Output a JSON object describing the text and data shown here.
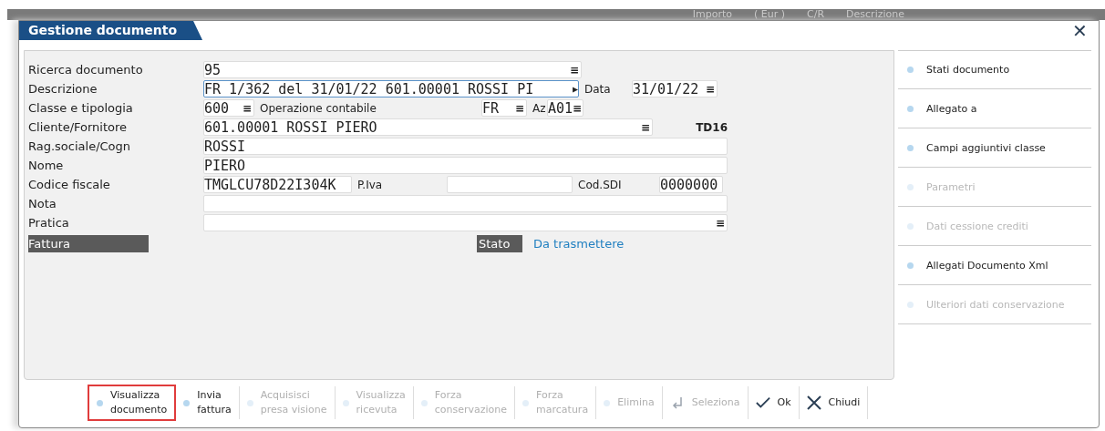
{
  "background_header": [
    "Importo",
    "( Eur )",
    "C/R",
    "Descrizione"
  ],
  "window": {
    "title": "Gestione documento",
    "close": "✕"
  },
  "form": {
    "rows": [
      {
        "label": "Ricerca documento",
        "items": [
          {
            "kind": "field",
            "value": "95",
            "menu": "≡",
            "focused": false
          }
        ]
      },
      {
        "label": "Descrizione",
        "items": [
          {
            "kind": "field",
            "value": "FR 1/362 del 31/01/22 601.00001 ROSSI PI",
            "arrow": "▶",
            "focused": true
          },
          {
            "kind": "text",
            "value": "Data"
          },
          {
            "kind": "field",
            "value": "31/01/22",
            "menu": "≡",
            "focused": false
          }
        ]
      },
      {
        "label": "Classe e tipologia",
        "items": [
          {
            "kind": "field",
            "value": "600",
            "menu": "≡",
            "focused": false
          },
          {
            "kind": "text",
            "value": "Operazione contabile"
          },
          {
            "kind": "field",
            "value": "FR",
            "menu": "≡",
            "focused": false
          },
          {
            "kind": "text",
            "value": "Az"
          },
          {
            "kind": "field",
            "value": "A01",
            "menu": "≡",
            "focused": false
          }
        ]
      },
      {
        "label": "Cliente/Fornitore",
        "items": [
          {
            "kind": "field",
            "value": "601.00001 ROSSI PIERO",
            "menu": "≡",
            "focused": false
          },
          {
            "kind": "text",
            "value": "TD16"
          }
        ]
      },
      {
        "label": "Rag.sociale/Cogn",
        "items": [
          {
            "kind": "field",
            "value": "ROSSI",
            "focused": false
          }
        ]
      },
      {
        "label": "Nome",
        "items": [
          {
            "kind": "field",
            "value": "PIERO",
            "focused": false
          }
        ]
      },
      {
        "label": "Codice fiscale",
        "items": [
          {
            "kind": "field",
            "value": "TMGLCU78D22I304K",
            "focused": false
          },
          {
            "kind": "text",
            "value": "P.Iva"
          },
          {
            "kind": "field",
            "value": "",
            "focused": false
          },
          {
            "kind": "text",
            "value": "Cod.SDI"
          },
          {
            "kind": "field",
            "value": "0000000",
            "focused": false
          }
        ]
      },
      {
        "label": "Nota",
        "items": [
          {
            "kind": "field",
            "value": "",
            "focused": false
          }
        ]
      },
      {
        "label": "Pratica",
        "items": [
          {
            "kind": "field",
            "value": "",
            "menu": "≡",
            "focused": false
          }
        ]
      }
    ],
    "section": {
      "title": "Fattura",
      "status_label": "Stato",
      "status_value": "Da trasmettere"
    }
  },
  "side_menu": [
    {
      "label": "Stati documento",
      "disabled": false
    },
    {
      "label": "Allegato a",
      "disabled": false
    },
    {
      "label": "Campi aggiuntivi classe",
      "disabled": false
    },
    {
      "label": "Parametri",
      "disabled": true
    },
    {
      "label": "Dati cessione crediti",
      "disabled": true
    },
    {
      "label": "Allegati Documento Xml",
      "disabled": false
    },
    {
      "label": "Ulteriori dati conservazione",
      "disabled": true
    }
  ],
  "toolbar": [
    {
      "kind": "dot",
      "lines": [
        "Visualizza",
        "documento"
      ],
      "disabled": false,
      "highlighted": true
    },
    {
      "kind": "dot",
      "lines": [
        "Invia",
        "fattura"
      ],
      "disabled": false,
      "highlighted": false
    },
    {
      "kind": "dot",
      "lines": [
        "Acquisisci",
        "presa visione"
      ],
      "disabled": true,
      "highlighted": false
    },
    {
      "kind": "dot",
      "lines": [
        "Visualizza",
        "ricevuta"
      ],
      "disabled": true,
      "highlighted": false
    },
    {
      "kind": "dot",
      "lines": [
        "Forza",
        "conservazione"
      ],
      "disabled": true,
      "highlighted": false
    },
    {
      "kind": "dot",
      "lines": [
        "Forza",
        "marcatura"
      ],
      "disabled": true,
      "highlighted": false
    },
    {
      "kind": "dot",
      "lines": [
        "Elimina"
      ],
      "disabled": true,
      "highlighted": false
    },
    {
      "kind": "enter",
      "lines": [
        "Seleziona"
      ],
      "disabled": true,
      "highlighted": false
    },
    {
      "kind": "check",
      "lines": [
        "Ok"
      ],
      "disabled": false,
      "highlighted": false
    },
    {
      "kind": "cross",
      "lines": [
        "Chiudi"
      ],
      "disabled": false,
      "highlighted": false
    }
  ]
}
